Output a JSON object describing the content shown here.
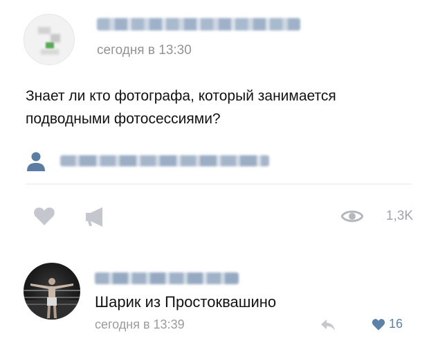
{
  "post": {
    "time": "сегодня в 13:30",
    "text": "Знает ли кто фотографа, который занимается\nподводными фотосессиями?",
    "views": "1,3K"
  },
  "comment": {
    "text": "Шарик из Простоквашино",
    "time": "сегодня в 13:39",
    "likes": "16"
  },
  "icons": {
    "author": "person-icon",
    "like": "heart-icon",
    "share": "megaphone-icon",
    "views": "eye-icon",
    "reply": "reply-arrow-icon",
    "comment_like": "heart-icon"
  },
  "colors": {
    "secondary_text": "#939393",
    "icon_gray": "#c4c8ce",
    "accent": "#5e81a8"
  }
}
